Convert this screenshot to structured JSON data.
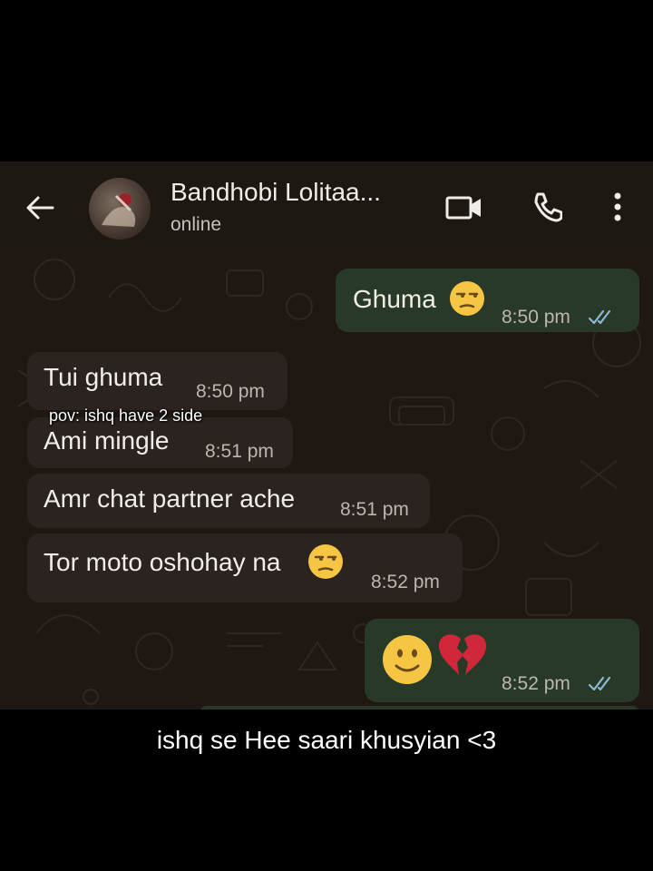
{
  "header": {
    "contact_name": "Bandhobi Lolitaa...",
    "status": "online"
  },
  "messages": [
    {
      "direction": "outgoing",
      "text": "Ghuma",
      "emoji": "unamused-face",
      "time": "8:50 pm",
      "ticks": "read"
    },
    {
      "direction": "incoming",
      "text": "Tui ghuma",
      "time": "8:50 pm"
    },
    {
      "direction": "incoming",
      "text": "Ami mingle",
      "time": "8:51 pm"
    },
    {
      "direction": "incoming",
      "text": "Amr chat partner ache",
      "time": "8:51 pm"
    },
    {
      "direction": "incoming",
      "text": "Tor moto oshohay na",
      "emoji": "unamused-face",
      "time": "8:52 pm"
    },
    {
      "direction": "outgoing",
      "text": "",
      "emoji": "slightly-smiling-face broken-heart",
      "time": "8:52 pm",
      "ticks": "read"
    }
  ],
  "overlay_text": "pov: ishq have 2 side",
  "caption": "ishq se Hee saari khusyian <3",
  "colors": {
    "outgoing_bubble": "#283a27",
    "incoming_bubble": "#2b2320",
    "read_ticks": "#8fb7d6",
    "background": "#1f1812"
  }
}
